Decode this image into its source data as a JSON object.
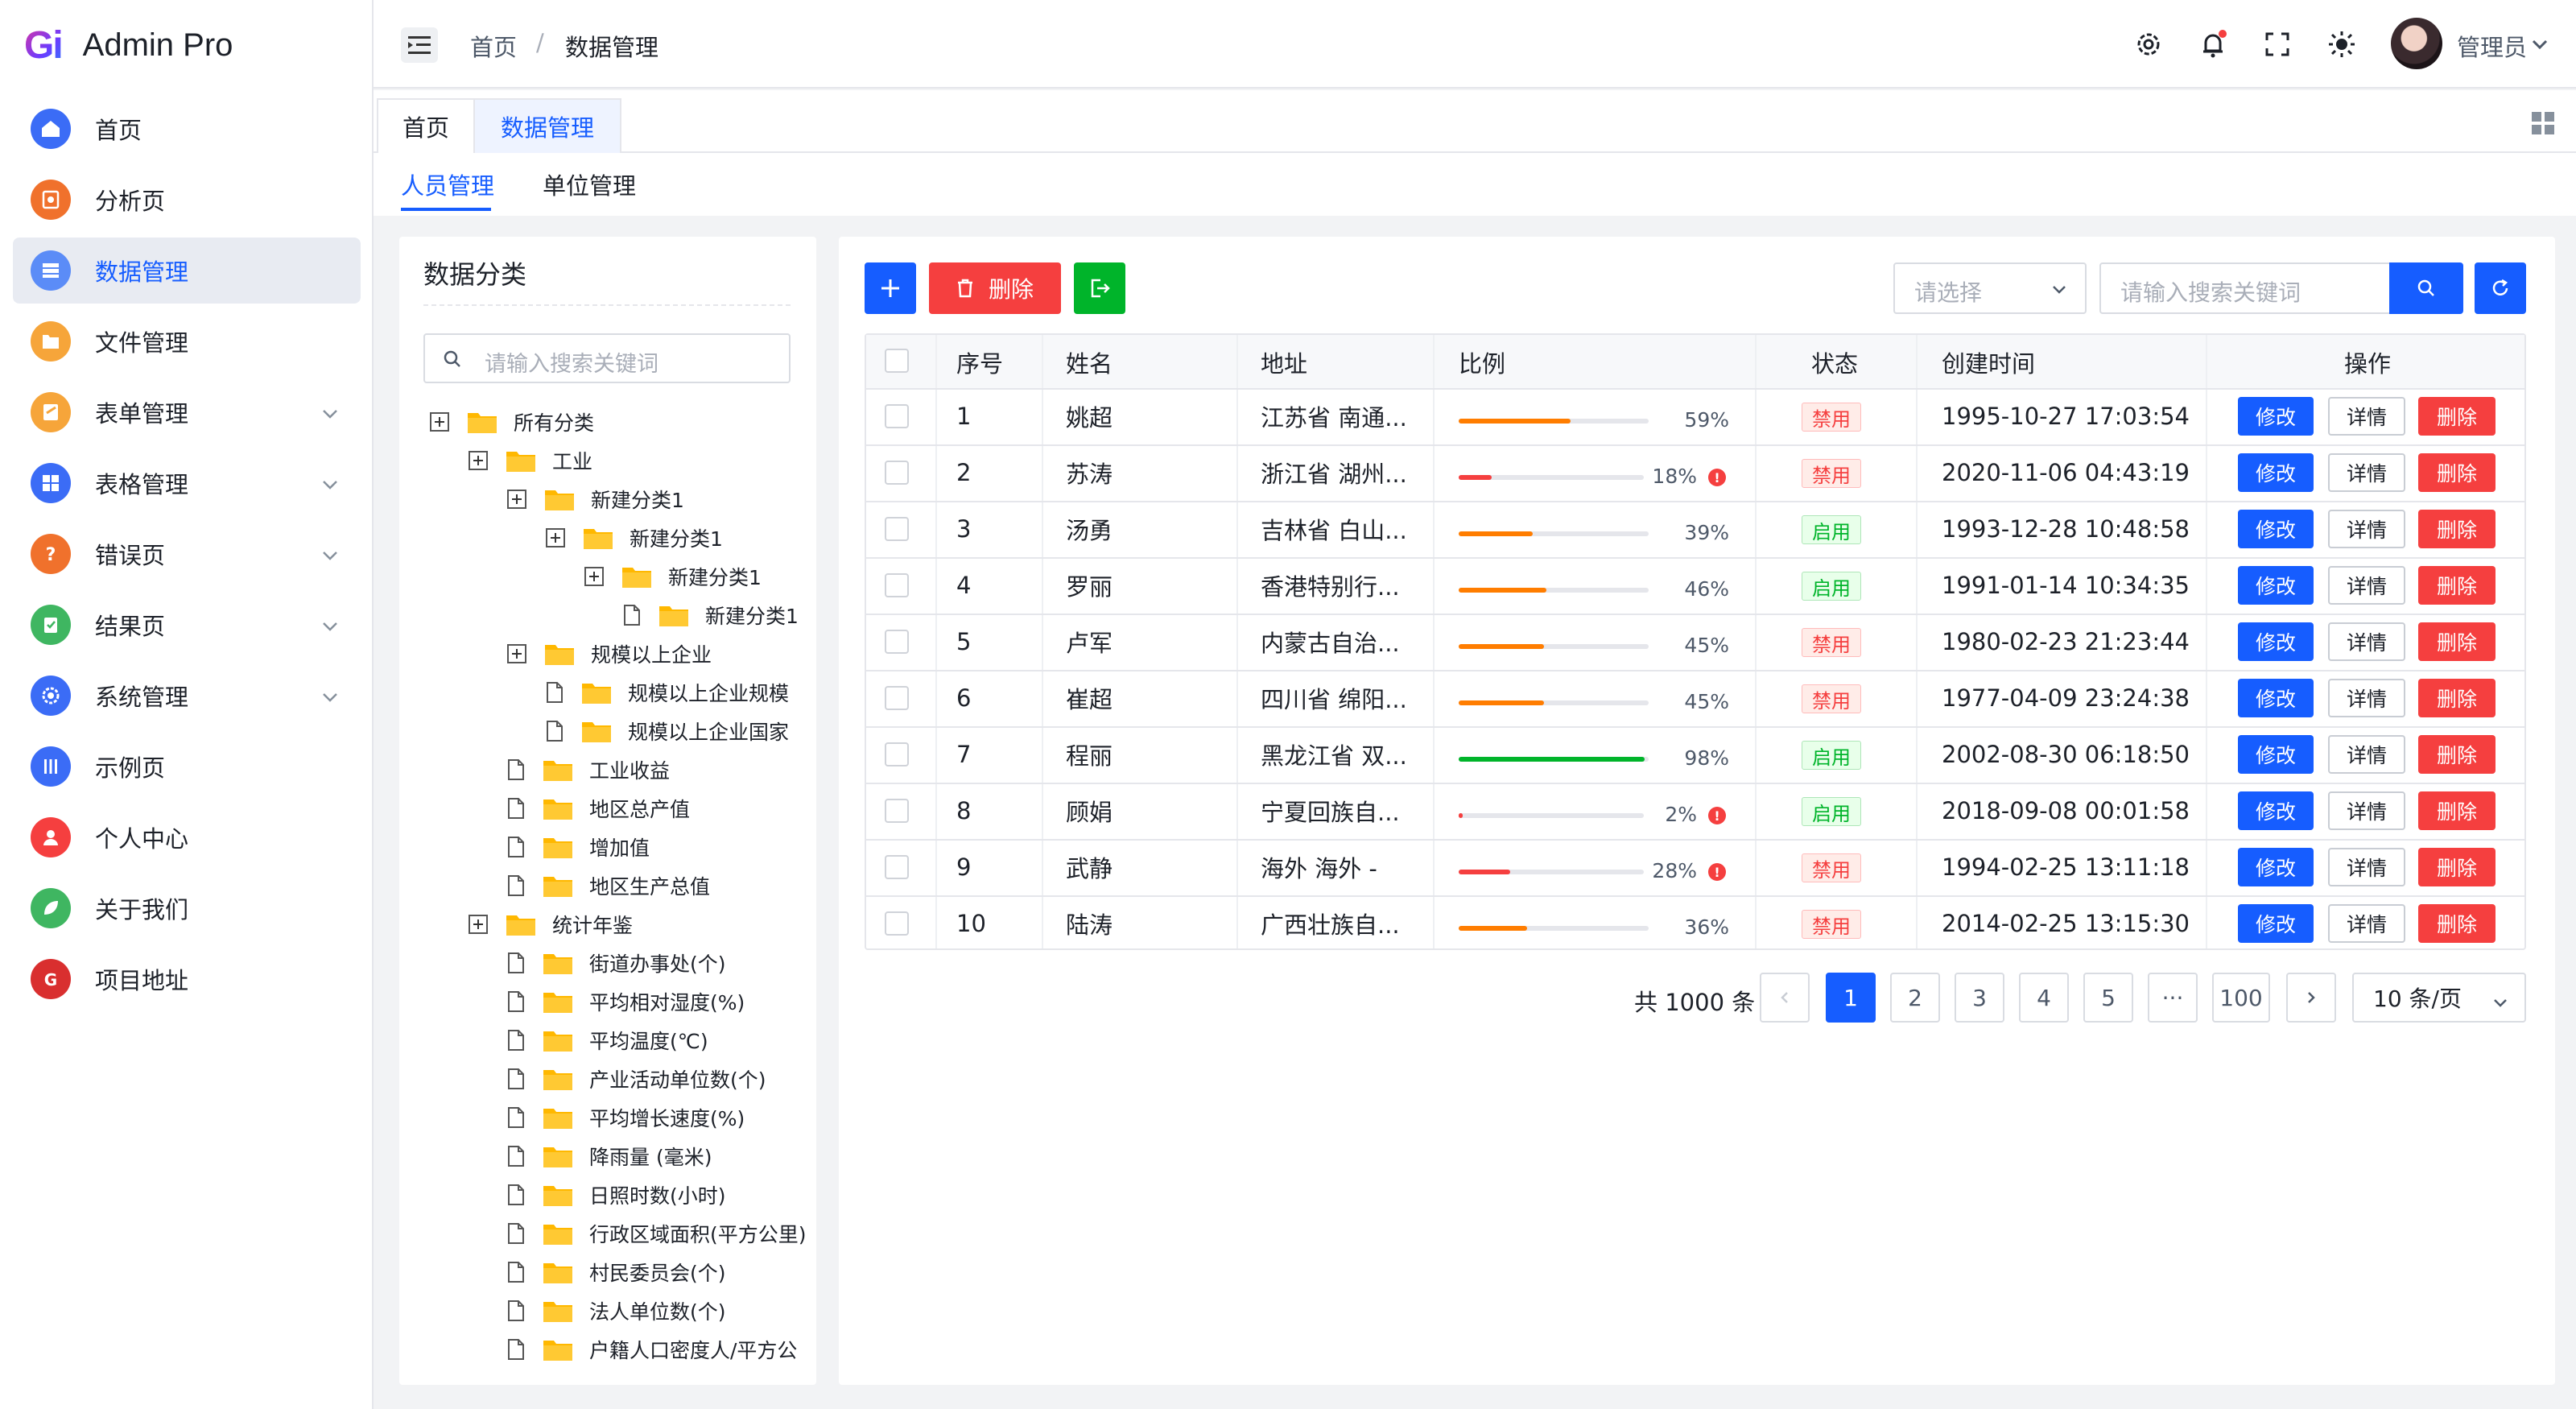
{
  "app": {
    "logo_mark": "Gi",
    "title": "Admin Pro"
  },
  "sidebar": {
    "items": [
      {
        "label": "首页",
        "icon": "home-icon",
        "color": "#3b6cf6"
      },
      {
        "label": "分析页",
        "icon": "analysis-icon",
        "color": "#f0712c"
      },
      {
        "label": "数据管理",
        "icon": "data-icon",
        "color": "#5b8cf7"
      },
      {
        "label": "文件管理",
        "icon": "file-icon",
        "color": "#f6a53a"
      },
      {
        "label": "表单管理",
        "icon": "form-icon",
        "color": "#f6a53a"
      },
      {
        "label": "表格管理",
        "icon": "table-icon",
        "color": "#3b6cf6"
      },
      {
        "label": "错误页",
        "icon": "error-icon",
        "color": "#f0712c"
      },
      {
        "label": "结果页",
        "icon": "result-icon",
        "color": "#3fb661"
      },
      {
        "label": "系统管理",
        "icon": "system-icon",
        "color": "#3b6cf6"
      },
      {
        "label": "示例页",
        "icon": "example-icon",
        "color": "#3b6cf6"
      },
      {
        "label": "个人中心",
        "icon": "user-icon",
        "color": "#f53f3f"
      },
      {
        "label": "关于我们",
        "icon": "leaf-icon",
        "color": "#3fb661"
      },
      {
        "label": "项目地址",
        "icon": "gitee-icon",
        "color": "#d92f2f"
      }
    ]
  },
  "header": {
    "breadcrumb_home": "首页",
    "breadcrumb_sep": "/",
    "breadcrumb_current": "数据管理",
    "user_name": "管理员"
  },
  "tabs": [
    {
      "label": "首页"
    },
    {
      "label": "数据管理"
    }
  ],
  "subtabs": [
    {
      "label": "人员管理"
    },
    {
      "label": "单位管理"
    }
  ],
  "tree": {
    "title": "数据分类",
    "search_placeholder": "请输入搜索关键词",
    "nodes": [
      {
        "label": "所有分类"
      },
      {
        "label": "工业"
      },
      {
        "label": "新建分类1"
      },
      {
        "label": "新建分类1"
      },
      {
        "label": "新建分类1"
      },
      {
        "label": "新建分类1"
      },
      {
        "label": "规模以上企业"
      },
      {
        "label": "规模以上企业规模"
      },
      {
        "label": "规模以上企业国家"
      },
      {
        "label": "工业收益"
      },
      {
        "label": "地区总产值"
      },
      {
        "label": "增加值"
      },
      {
        "label": "地区生产总值"
      },
      {
        "label": "统计年鉴"
      },
      {
        "label": "街道办事处(个)"
      },
      {
        "label": "平均相对湿度(%)"
      },
      {
        "label": "平均温度(℃)"
      },
      {
        "label": "产业活动单位数(个)"
      },
      {
        "label": "平均增长速度(%)"
      },
      {
        "label": "降雨量 (毫米)"
      },
      {
        "label": "日照时数(小时)"
      },
      {
        "label": "行政区域面积(平方公里)"
      },
      {
        "label": "村民委员会(个)"
      },
      {
        "label": "法人单位数(个)"
      },
      {
        "label": "户籍人口密度人/平方公"
      }
    ]
  },
  "toolbar": {
    "delete_label": "删除",
    "select_placeholder": "请选择",
    "search_placeholder": "请输入搜索关键词"
  },
  "table": {
    "columns": [
      "序号",
      "姓名",
      "地址",
      "比例",
      "状态",
      "创建时间",
      "操作"
    ],
    "actions": {
      "edit": "修改",
      "detail": "详情",
      "delete": "删除"
    },
    "rows": [
      {
        "id": "1",
        "name": "姚超",
        "address": "江苏省 南通...",
        "ratio": 59,
        "ratio_label": "59%",
        "status": "禁用",
        "created": "1995-10-27 17:03:54"
      },
      {
        "id": "2",
        "name": "苏涛",
        "address": "浙江省 湖州...",
        "ratio": 18,
        "ratio_label": "18%",
        "status": "禁用",
        "created": "2020-11-06 04:43:19"
      },
      {
        "id": "3",
        "name": "汤勇",
        "address": "吉林省 白山...",
        "ratio": 39,
        "ratio_label": "39%",
        "status": "启用",
        "created": "1993-12-28 10:48:58"
      },
      {
        "id": "4",
        "name": "罗丽",
        "address": "香港特别行...",
        "ratio": 46,
        "ratio_label": "46%",
        "status": "启用",
        "created": "1991-01-14 10:34:35"
      },
      {
        "id": "5",
        "name": "卢军",
        "address": "内蒙古自治...",
        "ratio": 45,
        "ratio_label": "45%",
        "status": "禁用",
        "created": "1980-02-23 21:23:44"
      },
      {
        "id": "6",
        "name": "崔超",
        "address": "四川省 绵阳...",
        "ratio": 45,
        "ratio_label": "45%",
        "status": "禁用",
        "created": "1977-04-09 23:24:38"
      },
      {
        "id": "7",
        "name": "程丽",
        "address": "黑龙江省 双...",
        "ratio": 98,
        "ratio_label": "98%",
        "status": "启用",
        "created": "2002-08-30 06:18:50"
      },
      {
        "id": "8",
        "name": "顾娟",
        "address": "宁夏回族自...",
        "ratio": 2,
        "ratio_label": "2%",
        "status": "启用",
        "created": "2018-09-08 00:01:58"
      },
      {
        "id": "9",
        "name": "武静",
        "address": "海外 海外 -",
        "ratio": 28,
        "ratio_label": "28%",
        "status": "禁用",
        "created": "1994-02-25 13:11:18"
      },
      {
        "id": "10",
        "name": "陆涛",
        "address": "广西壮族自...",
        "ratio": 36,
        "ratio_label": "36%",
        "status": "禁用",
        "created": "2014-02-25 13:15:30"
      }
    ]
  },
  "pagination": {
    "total": "共 1000 条",
    "pages": [
      "1",
      "2",
      "3",
      "4",
      "5",
      "···",
      "100"
    ],
    "current": "1",
    "page_size": "10 条/页"
  },
  "colors": {
    "primary": "#165dff",
    "danger": "#f53f3f",
    "success": "#00b42a",
    "warning": "#ff7d00",
    "folder": "#ffb800"
  }
}
